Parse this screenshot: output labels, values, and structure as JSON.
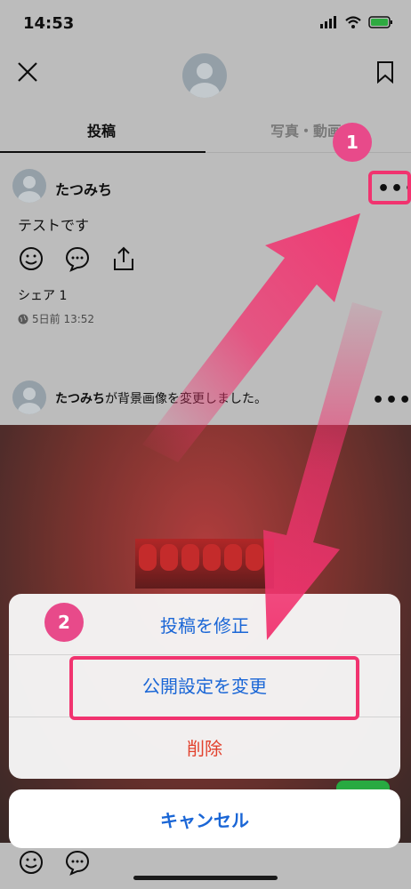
{
  "status": {
    "time": "14:53"
  },
  "tabs": {
    "posts": "投稿",
    "photos": "写真・動画"
  },
  "post1": {
    "user": "たつみち",
    "text": "テストです",
    "share": "シェア 1",
    "time": "5日前 13:52",
    "more": "•••"
  },
  "post2": {
    "user": "たつみち",
    "action": "が背景画像を変更しました。",
    "more": "•••"
  },
  "sheet": {
    "edit": "投稿を修正",
    "visibility": "公開設定を変更",
    "delete": "削除",
    "cancel": "キャンセル"
  },
  "annotations": {
    "step1": "1",
    "step2": "2"
  },
  "colors": {
    "accent": "#1a66d6",
    "destructive": "#e2412d",
    "annotation": "#f1336f"
  },
  "icons": [
    "close-icon",
    "bookmark-icon",
    "smile-icon",
    "comment-icon",
    "share-icon",
    "globe-icon",
    "more-icon"
  ]
}
